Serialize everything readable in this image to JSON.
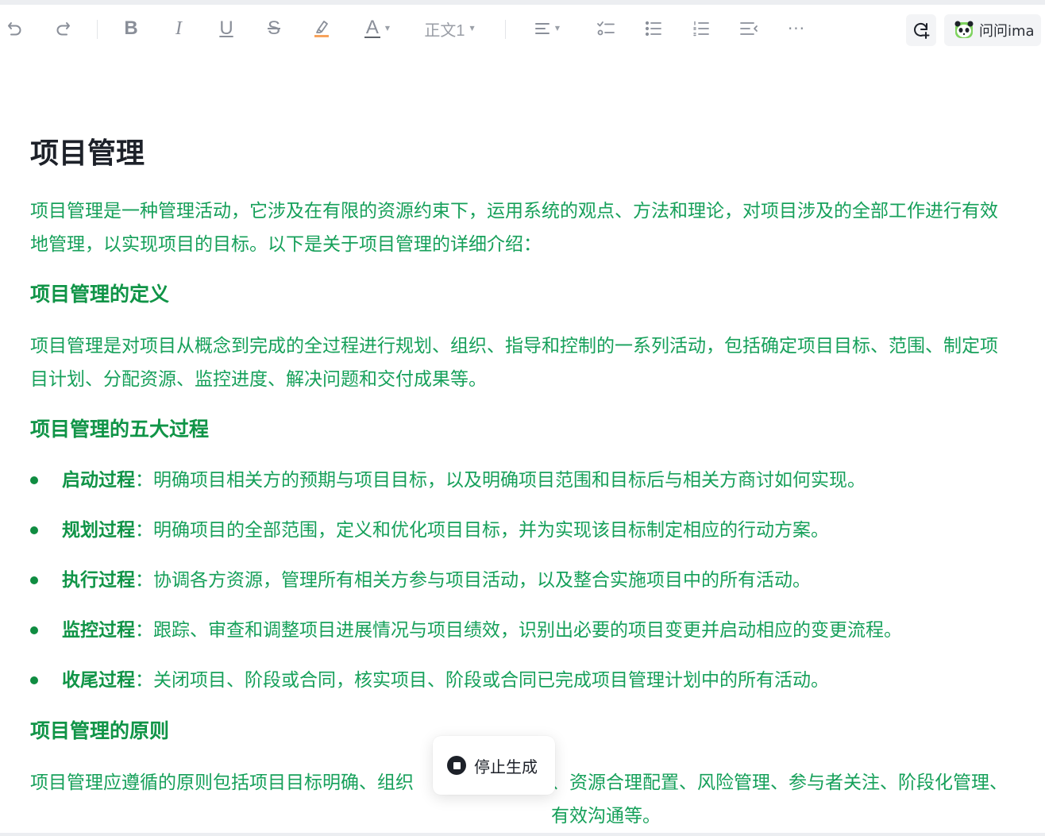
{
  "toolbar": {
    "bold_glyph": "B",
    "italic_glyph": "I",
    "underline_glyph": "U",
    "strike_glyph": "S",
    "font_color_glyph": "A",
    "text_style": "正文1",
    "more": "···",
    "ask_label": "问问ima",
    "highlight_color": "#f7a35c"
  },
  "doc": {
    "title": "项目管理",
    "intro": "项目管理是一种管理活动，它涉及在有限的资源约束下，运用系统的观点、方法和理论，对项目涉及的全部工作进行有效地管理，以实现项目的目标。以下是关于项目管理的详细介绍：",
    "h_definition": "项目管理的定义",
    "definition": "项目管理是对项目从概念到完成的全过程进行规划、组织、指导和控制的一系列活动，包括确定项目目标、范围、制定项目计划、分配资源、监控进度、解决问题和交付成果等。",
    "h_processes": "项目管理的五大过程",
    "processes": [
      {
        "term": "启动过程",
        "sep": "：",
        "desc": "明确项目相关方的预期与项目目标，以及明确项目范围和目标后与相关方商讨如何实现。"
      },
      {
        "term": "规划过程",
        "sep": "：",
        "desc": "明确项目的全部范围，定义和优化项目目标，并为实现该目标制定相应的行动方案。"
      },
      {
        "term": "执行过程",
        "sep": "：",
        "desc": "协调各方资源，管理所有相关方参与项目活动，以及整合实施项目中的所有活动。"
      },
      {
        "term": "监控过程",
        "sep": "：",
        "desc": "跟踪、审查和调整项目进展情况与项目绩效，识别出必要的项目变更并启动相应的变更流程。"
      },
      {
        "term": "收尾过程",
        "sep": "：",
        "desc": "关闭项目、阶段或合同，核实项目、阶段或合同已完成项目管理计划中的所有活动。"
      }
    ],
    "h_principles": "项目管理的原则",
    "principles_visible_a": "项目管理应遵循的原则包括项目目标明确、组织",
    "principles_visible_b": "、资源合理配置、风险管理、参与者关注、阶段化管理、有效沟通等。"
  },
  "stop": {
    "label": "停止生成"
  },
  "colors": {
    "body_text": "#16a05a",
    "heading_green": "#109447",
    "title": "#1d2129"
  }
}
